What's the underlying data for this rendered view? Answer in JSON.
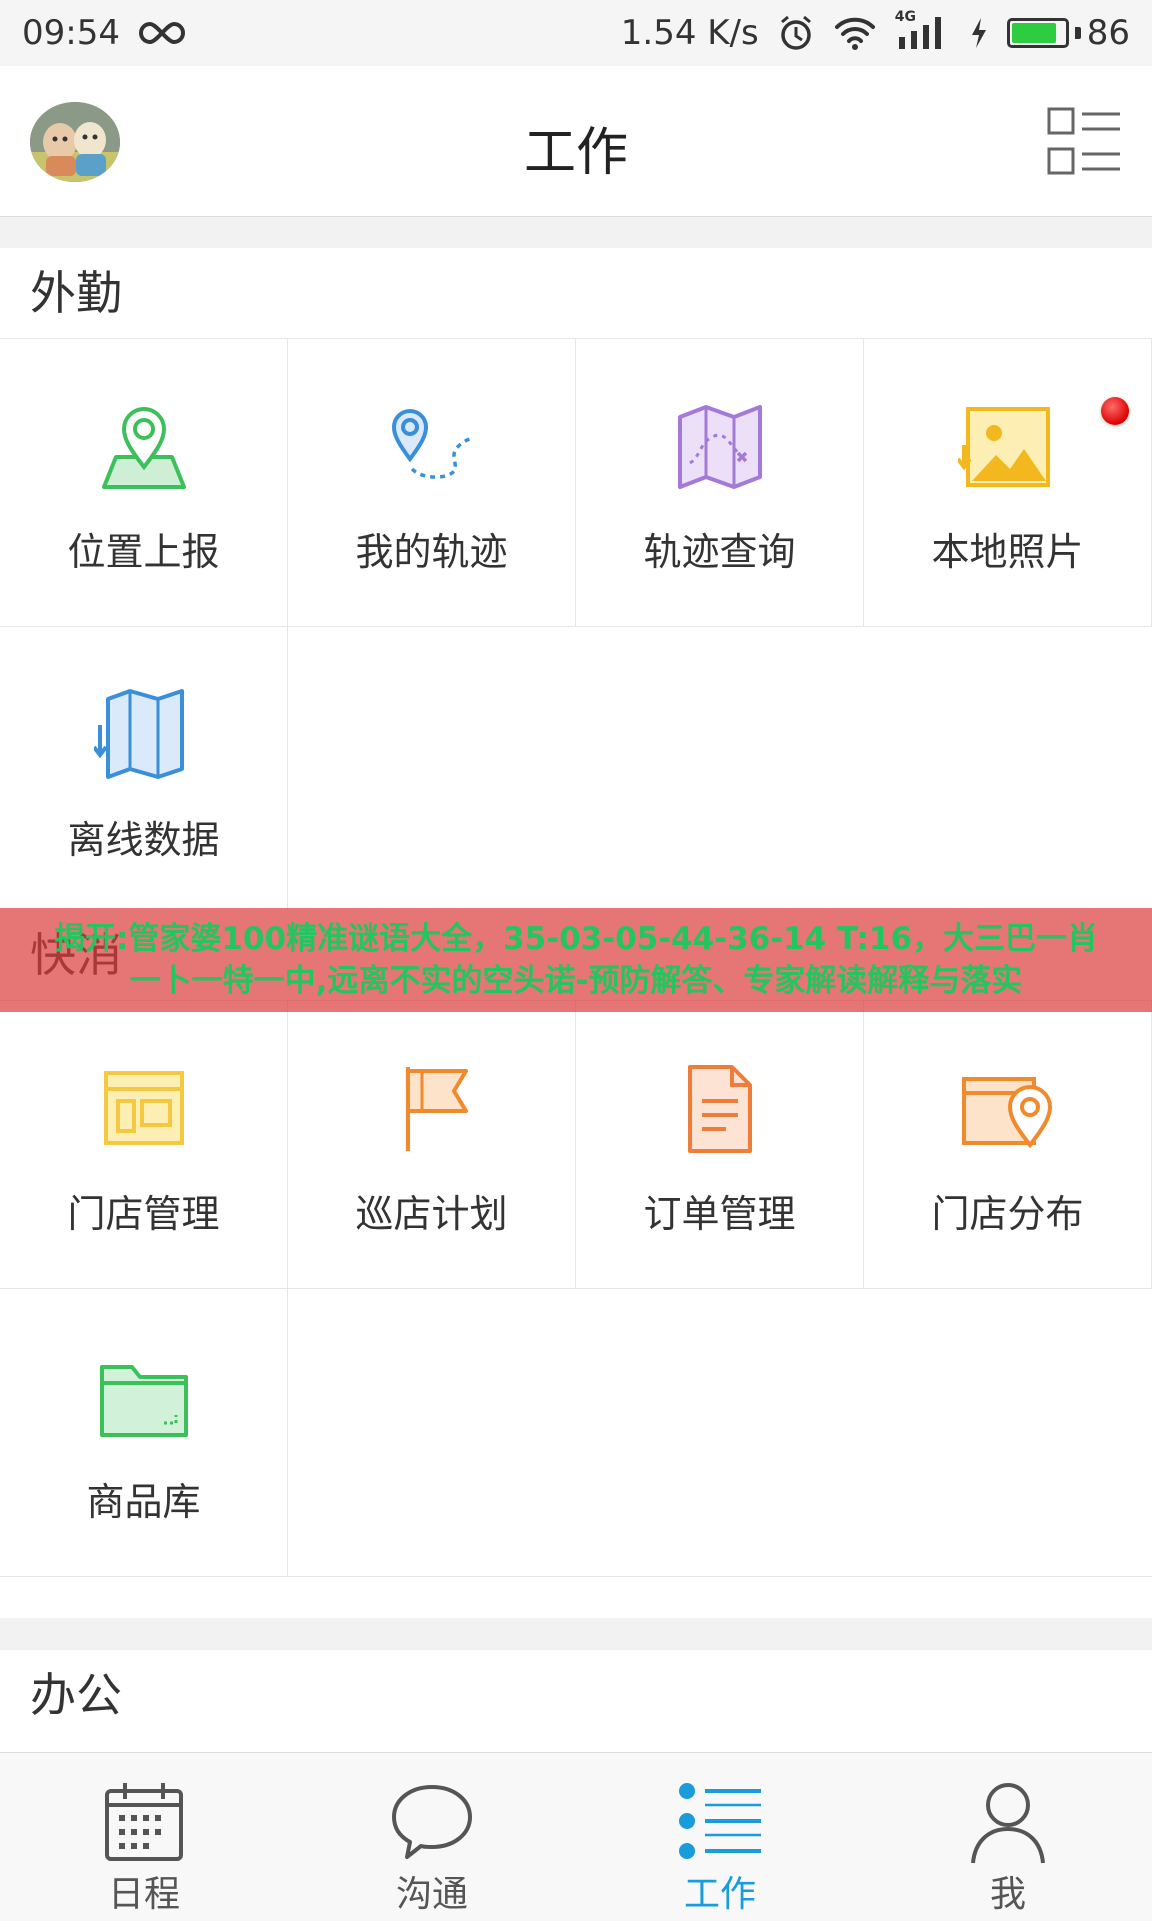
{
  "status_bar": {
    "time": "09:54",
    "network_speed": "1.54 K/s",
    "network_type": "4G",
    "battery_level": "86",
    "battery_fill": 0.86
  },
  "header": {
    "title": "工作",
    "avatar_icon": "avatar-icon",
    "menu_icon": "grid-list-icon"
  },
  "sections": {
    "field": {
      "title": "外勤",
      "items": [
        {
          "label": "位置上报",
          "icon": "location-report-icon",
          "color": "#3cc05a"
        },
        {
          "label": "我的轨迹",
          "icon": "my-track-icon",
          "color": "#3a8fd8"
        },
        {
          "label": "轨迹查询",
          "icon": "track-query-icon",
          "color": "#a47ad8"
        },
        {
          "label": "本地照片",
          "icon": "local-photo-icon",
          "color": "#f2b81d"
        },
        {
          "label": "离线数据",
          "icon": "offline-data-icon",
          "color": "#3a8fd8"
        }
      ]
    },
    "fast_sales": {
      "title": "快消",
      "items": [
        {
          "label": "门店管理",
          "icon": "store-management-icon",
          "color": "#f5c842"
        },
        {
          "label": "巡店计划",
          "icon": "patrol-plan-icon",
          "color": "#f08a2c"
        },
        {
          "label": "订单管理",
          "icon": "order-management-icon",
          "color": "#ef7d3a"
        },
        {
          "label": "门店分布",
          "icon": "store-distribution-icon",
          "color": "#f08a2c"
        },
        {
          "label": "商品库",
          "icon": "product-library-icon",
          "color": "#3cc05a"
        }
      ]
    },
    "office": {
      "title": "办公"
    }
  },
  "overlay_text": "揭开:管家婆100精准谜语大全，35-03-05-44-36-14 T:16，大三巴一肖一卜一特一中,远离不实的空头诺-预防解答、专家解读解释与落实",
  "tabs": [
    {
      "label": "日程",
      "icon": "calendar-icon"
    },
    {
      "label": "沟通",
      "icon": "chat-bubble-icon"
    },
    {
      "label": "工作",
      "icon": "work-list-icon",
      "active": true
    },
    {
      "label": "我",
      "icon": "profile-icon"
    }
  ],
  "colors": {
    "accent": "#1a9bdb",
    "notification_dot": "#e01010"
  }
}
